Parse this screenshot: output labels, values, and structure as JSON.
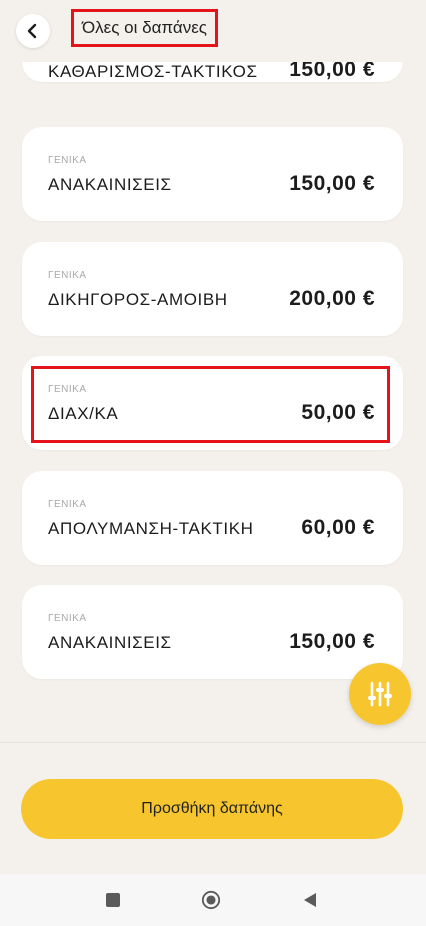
{
  "header": {
    "back_icon": "chevron-left-icon",
    "title": "Όλες οι δαπάνες"
  },
  "expenses": [
    {
      "category": "",
      "name": "ΚΑΘΑΡΙΣΜΟΣ-ΤΑΚΤΙΚΟΣ",
      "amount": "150,00 €"
    },
    {
      "category": "ΓΕΝΙΚΑ",
      "name": "ΑΝΑΚΑΙΝΙΣΕΙΣ",
      "amount": "150,00 €"
    },
    {
      "category": "ΓΕΝΙΚΑ",
      "name": "ΔΙΚΗΓΟΡΟΣ-ΑΜΟΙΒΗ",
      "amount": "200,00 €"
    },
    {
      "category": "ΓΕΝΙΚΑ",
      "name": "ΔΙΑΧ/ΚΑ",
      "amount": "50,00 €"
    },
    {
      "category": "ΓΕΝΙΚΑ",
      "name": "ΑΠΟΛΥΜΑΝΣΗ-ΤΑΚΤΙΚΗ",
      "amount": "60,00 €"
    },
    {
      "category": "ΓΕΝΙΚΑ",
      "name": "ΑΝΑΚΑΙΝΙΣΕΙΣ",
      "amount": "150,00 €"
    }
  ],
  "filter_fab": {
    "icon": "sliders-icon"
  },
  "footer": {
    "add_button_label": "Προσθήκη δαπάνης"
  },
  "system_nav": {
    "icons": [
      "recents-square-icon",
      "home-circle-icon",
      "back-triangle-icon"
    ]
  },
  "colors": {
    "accent": "#f7c62f",
    "background": "#f4f1ec",
    "card": "#ffffff",
    "highlight": "#e5141b"
  }
}
